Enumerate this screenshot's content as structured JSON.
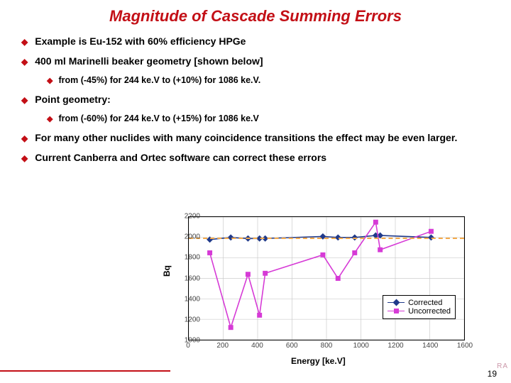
{
  "title": "Magnitude of Cascade Summing Errors",
  "bullets": {
    "b1": "Example is Eu-152 with 60% efficiency HPGe",
    "b2": "400 ml Marinelli beaker geometry [shown below]",
    "b2a": "from (-45%) for 244 ke.V to (+10%) for 1086 ke.V.",
    "b3": "Point geometry:",
    "b3a": "from (-60%) for 244 ke.V to (+15%) for 1086 ke.V",
    "b4": "For many other nuclides with many coincidence transitions the effect may be even larger.",
    "b5": "Current Canberra and Ortec software can correct these errors"
  },
  "legend": {
    "corrected": "Corrected",
    "uncorrected": "Uncorrected"
  },
  "axes": {
    "x": "Energy [ke.V]",
    "y": "Bq"
  },
  "page": "19",
  "chart_data": {
    "type": "scatter",
    "title": "",
    "xlabel": "Energy [ke.V]",
    "ylabel": "Bq",
    "xlim": [
      0,
      1600
    ],
    "ylim": [
      1000,
      2200
    ],
    "xticks": [
      0,
      200,
      400,
      600,
      800,
      1000,
      1200,
      1400,
      1600
    ],
    "yticks": [
      1000,
      1200,
      1400,
      1600,
      1800,
      2000,
      2200
    ],
    "ref_line": 2000,
    "series": [
      {
        "name": "Corrected",
        "color": "#203a8a",
        "marker": "diamond",
        "x": [
          122,
          244,
          344,
          411,
          444,
          779,
          867,
          964,
          1086,
          1112,
          1408
        ],
        "y": [
          1980,
          2000,
          1990,
          1990,
          1990,
          2010,
          2000,
          2000,
          2020,
          2020,
          2000
        ]
      },
      {
        "name": "Uncorrected",
        "color": "#d63ad6",
        "marker": "square",
        "x": [
          122,
          244,
          344,
          411,
          444,
          779,
          867,
          964,
          1086,
          1112,
          1408
        ],
        "y": [
          1850,
          1120,
          1640,
          1240,
          1650,
          1830,
          1600,
          1850,
          2150,
          1880,
          2060
        ]
      }
    ]
  }
}
